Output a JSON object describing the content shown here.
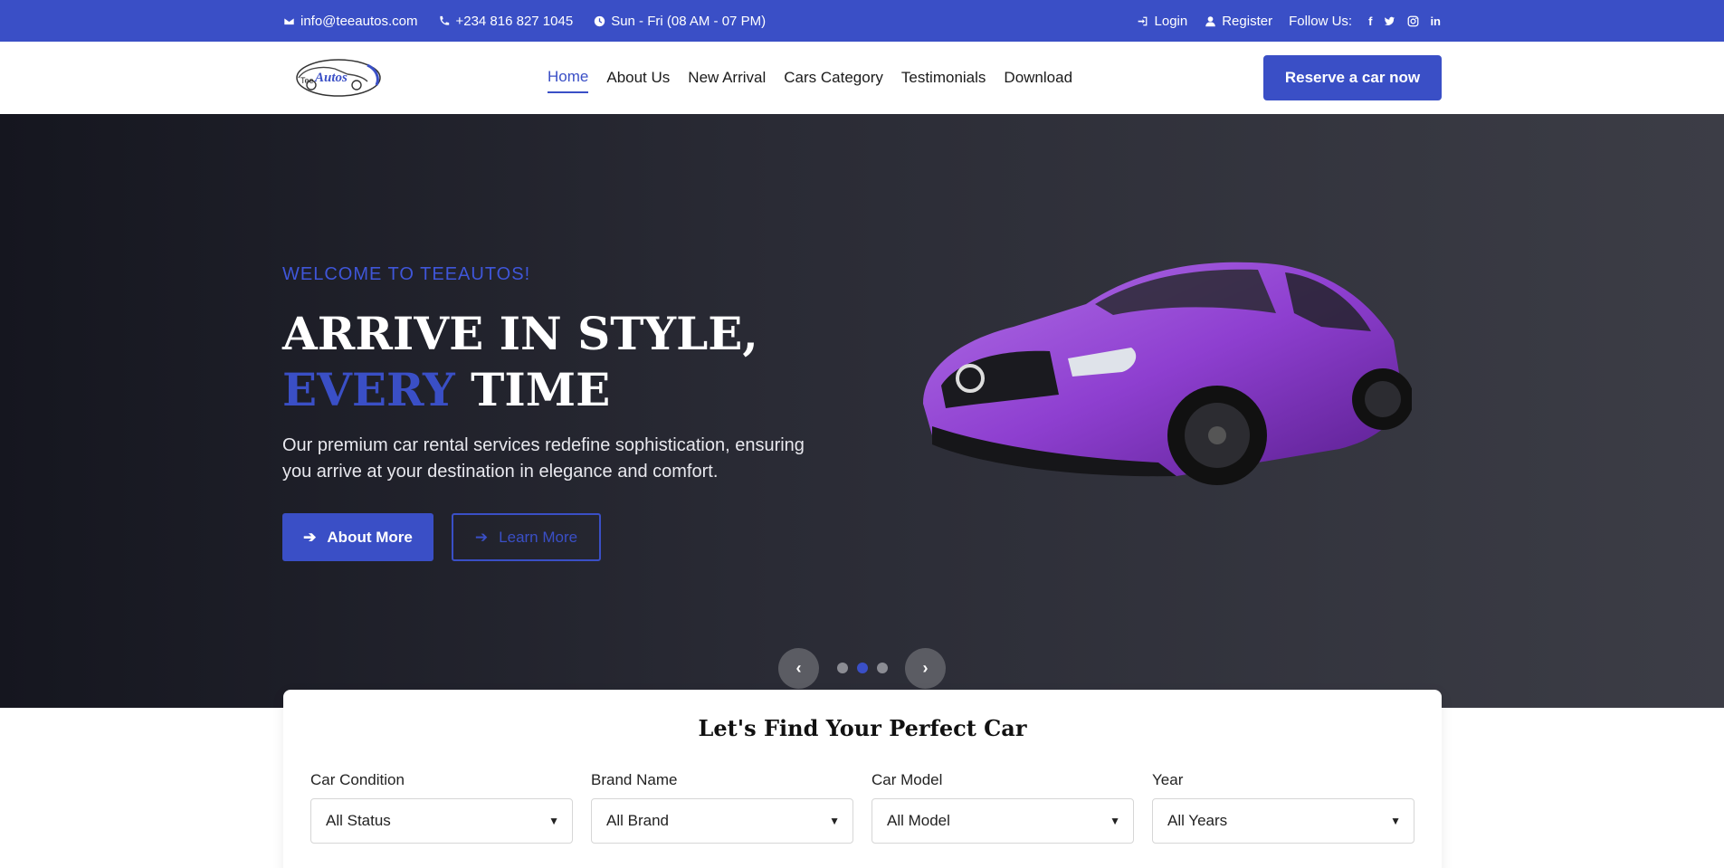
{
  "topbar": {
    "email": "info@teeautos.com",
    "phone": "+234 816 827 1045",
    "hours": "Sun - Fri (08 AM - 07 PM)",
    "login": "Login",
    "register": "Register",
    "follow": "Follow Us:",
    "social": [
      "f",
      "twitter-icon",
      "instagram-icon",
      "in"
    ]
  },
  "nav": {
    "logo_text": "TeeAutos",
    "items": [
      "Home",
      "About Us",
      "New Arrival",
      "Cars Category",
      "Testimonials",
      "Download"
    ],
    "active": "Home",
    "cta": "Reserve a car now"
  },
  "hero": {
    "welcome": "WELCOME TO TEEAUTOS!",
    "title_line1": "ARRIVE IN STYLE,",
    "title_blue": "EVERY",
    "title_rest": " TIME",
    "description": "Our premium car rental services redefine sophistication, ensuring you arrive at your destination in elegance and comfort.",
    "btn_about": "About More",
    "btn_learn": "Learn More"
  },
  "finder": {
    "title": "Let's Find Your Perfect Car",
    "fields": [
      {
        "label": "Car Condition",
        "value": "All Status"
      },
      {
        "label": "Brand Name",
        "value": "All Brand"
      },
      {
        "label": "Car Model",
        "value": "All Model"
      },
      {
        "label": "Year",
        "value": "All Years"
      }
    ]
  },
  "colors": {
    "accent": "#3a4fc6",
    "car": "#8e3fd0"
  }
}
